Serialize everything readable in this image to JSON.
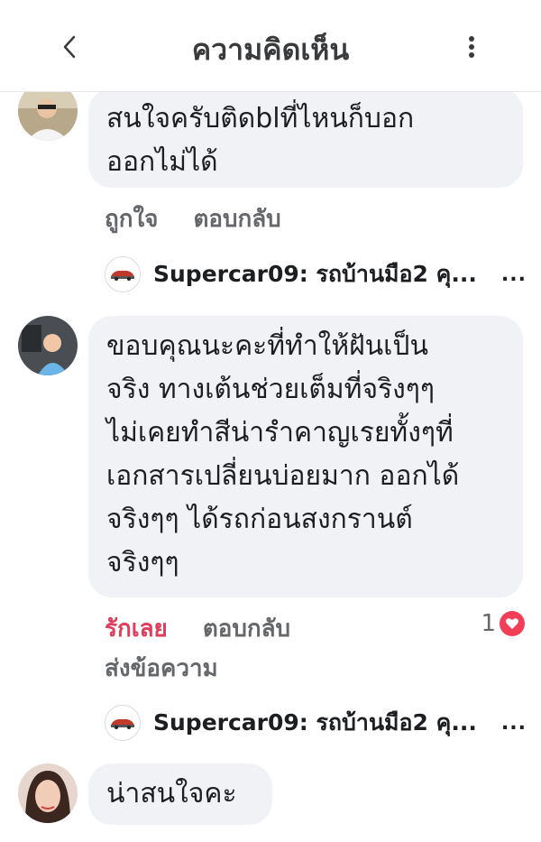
{
  "header": {
    "title": "ความคิดเห็น",
    "back_icon": "chevron-left-icon",
    "more_icon": "vertical-dots-icon"
  },
  "comments": [
    {
      "lines": [
        "สนใจครับติดblที่ไหนก็บอก",
        "ออกไม่ได้"
      ],
      "actions": [
        "ถูกใจ",
        "ตอบกลับ"
      ]
    },
    {
      "lines": [
        "ขอบคุณนะคะที่ทำให้ฝันเป็น",
        "จริง ทางเต้นช่วยเต็มที่จริงๆๆ",
        "ไม่เคยทำสีน่ารำคาญเรยทั้งๆที่",
        "เอกสารเปลี่ยนบ่อยมาก ออกได้",
        "จริงๆๆ  ได้รถก่อนสงกรานต์",
        "จริงๆๆ"
      ],
      "actions": [
        "รักเลย",
        "ตอบกลับ"
      ],
      "extra_action": "ส่งข้อความ",
      "reaction_count": "1"
    },
    {
      "lines": [
        "น่าสนใจคะ"
      ]
    }
  ],
  "replies": [
    {
      "name": "Supercar09: รถบ้านมือ2 คุ...",
      "more": "..."
    },
    {
      "name": "Supercar09: รถบ้านมือ2 คุ...",
      "more": "..."
    }
  ],
  "colors": {
    "love": "#e03c5c",
    "heart": "#f33e58",
    "bubble": "#f0f2f5",
    "secondary_text": "#65676b"
  }
}
